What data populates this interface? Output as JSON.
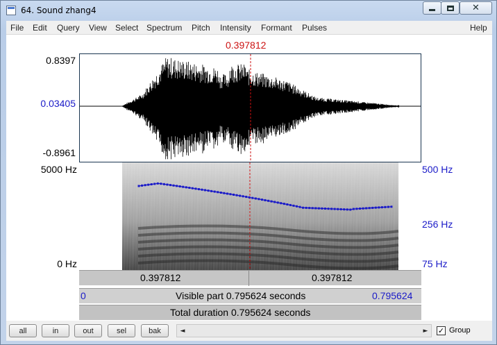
{
  "window": {
    "title": "64. Sound zhang4",
    "minimize_icon": "minimize-icon",
    "maximize_icon": "maximize-icon",
    "close_icon": "close-icon"
  },
  "menu": [
    {
      "label": "File"
    },
    {
      "label": "Edit"
    },
    {
      "label": "Query"
    },
    {
      "label": "View"
    },
    {
      "label": "Select"
    },
    {
      "label": "Spectrum"
    },
    {
      "label": "Pitch"
    },
    {
      "label": "Intensity"
    },
    {
      "label": "Formant"
    },
    {
      "label": "Pulses"
    },
    {
      "label": "Help"
    }
  ],
  "cursor": {
    "time_label": "0.397812",
    "time": 0.397812,
    "color": "#cc1111"
  },
  "waveform": {
    "max_label": "0.8397",
    "center_label": "0.03405",
    "min_label": "-0.8961",
    "max": 0.8397,
    "center": 0.03405,
    "min": -0.8961
  },
  "spectrogram": {
    "top_label": "5000 Hz",
    "bottom_label": "0 Hz",
    "max_hz": 5000,
    "min_hz": 0
  },
  "pitch": {
    "top_label": "500 Hz",
    "mid_label": "256 Hz",
    "bottom_label": "75 Hz",
    "color": "#1a1ac8",
    "min_hz": 75,
    "mid_hz": 256,
    "max_hz": 500,
    "points": [
      [
        0.0,
        0.55
      ],
      [
        0.05,
        0.53
      ],
      [
        0.1,
        0.515
      ],
      [
        0.15,
        0.5
      ],
      [
        0.2,
        0.485
      ],
      [
        0.25,
        0.47
      ],
      [
        0.3,
        0.455
      ],
      [
        0.35,
        0.44
      ],
      [
        0.4,
        0.425
      ],
      [
        0.45,
        0.41
      ],
      [
        0.5,
        0.395
      ],
      [
        0.55,
        0.38
      ],
      [
        0.6,
        0.365
      ],
      [
        0.65,
        0.35
      ],
      [
        0.7,
        0.335
      ],
      [
        0.75,
        0.32
      ],
      [
        0.8,
        0.305
      ],
      [
        0.85,
        0.29
      ],
      [
        0.9,
        0.275
      ],
      [
        0.95,
        0.26
      ],
      [
        1.0,
        0.245
      ],
      [
        1.05,
        0.23
      ],
      [
        1.1,
        0.215
      ],
      [
        1.15,
        0.2
      ],
      [
        1.2,
        0.185
      ],
      [
        1.25,
        0.17
      ],
      [
        1.3,
        0.155
      ],
      [
        1.35,
        0.14
      ],
      [
        1.4,
        0.125
      ],
      [
        1.45,
        0.11
      ],
      [
        1.5,
        0.095
      ],
      [
        1.55,
        0.08
      ],
      [
        1.6,
        0.065
      ],
      [
        1.65,
        0.05
      ],
      [
        1.7,
        0.035
      ],
      [
        1.75,
        0.02
      ],
      [
        1.8,
        0.005
      ],
      [
        1.85,
        -0.01
      ],
      [
        1.9,
        -0.025
      ],
      [
        1.95,
        -0.04
      ],
      [
        2.0,
        -0.055
      ],
      [
        2.05,
        -0.07
      ],
      [
        2.1,
        -0.085
      ],
      [
        2.15,
        -0.1
      ],
      [
        2.2,
        -0.115
      ],
      [
        2.25,
        -0.13
      ],
      [
        2.3,
        -0.145
      ],
      [
        2.35,
        -0.16
      ],
      [
        2.4,
        -0.175
      ],
      [
        2.45,
        -0.19
      ],
      [
        2.5,
        -0.205
      ],
      [
        2.55,
        -0.22
      ],
      [
        2.6,
        -0.235
      ],
      [
        2.65,
        -0.25
      ],
      [
        2.7,
        -0.265
      ],
      [
        2.75,
        -0.28
      ],
      [
        2.8,
        -0.295
      ],
      [
        2.85,
        -0.31
      ],
      [
        2.9,
        -0.325
      ],
      [
        2.95,
        -0.34
      ],
      [
        3.0,
        -0.355
      ]
    ]
  },
  "time_bars": {
    "left_time": "0.397812",
    "right_time": "0.397812",
    "visible_start": "0",
    "visible_text": "Visible part 0.795624 seconds",
    "visible_end": "0.795624",
    "total_text": "Total duration 0.795624 seconds"
  },
  "toolbar": {
    "buttons": [
      {
        "label": "all"
      },
      {
        "label": "in"
      },
      {
        "label": "out"
      },
      {
        "label": "sel"
      },
      {
        "label": "bak"
      }
    ],
    "scroll_left": "◄",
    "scroll_right": "►",
    "group_checked": "✓",
    "group_label": "Group"
  }
}
